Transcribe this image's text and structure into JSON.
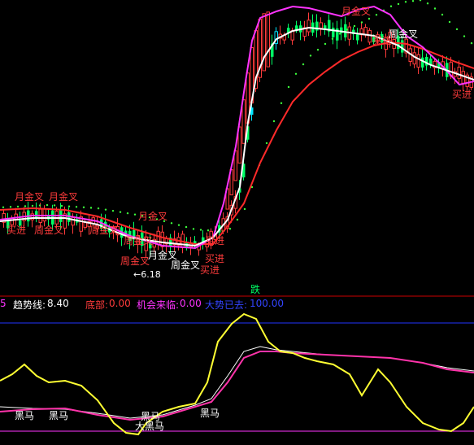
{
  "colors": {
    "background": "#000000",
    "up_candle": "#ff3b3b",
    "down_candle": "#00ff66",
    "cyan_candle": "#00e5ff",
    "ma_white": "#ffffff",
    "ma_magenta": "#ff33ff",
    "ma_red": "#ff2a2a",
    "dots": "#3cff3c",
    "signal_red": "#ff3b3b",
    "signal_white": "#ffffff",
    "axis_red": "#cc0000",
    "axis_blue": "#2233ff",
    "axis_magenta": "#ff33ff",
    "ind_yellow": "#ffff33",
    "ind_magenta": "#ff33aa",
    "ind_white": "#ffffff"
  },
  "price_panel": {
    "bottom_label": "跌",
    "low_marker": "6.18",
    "signals": [
      {
        "text": "周金叉",
        "color": "red"
      },
      {
        "text": "月金叉",
        "color": "red"
      },
      {
        "text": "买进",
        "color": "red"
      },
      {
        "text": "周金叉",
        "color": "red"
      },
      {
        "text": "月金叉",
        "color": "red"
      },
      {
        "text": "周金叉",
        "color": "red"
      },
      {
        "text": "月金叉",
        "color": "white"
      },
      {
        "text": "周金叉",
        "color": "white"
      },
      {
        "text": "买进",
        "color": "red"
      },
      {
        "text": "周金叉",
        "color": "red"
      },
      {
        "text": "月金叉",
        "color": "red"
      },
      {
        "text": "买进",
        "color": "red"
      },
      {
        "text": "买进",
        "color": "red"
      },
      {
        "text": "周金叉",
        "color": "white"
      },
      {
        "text": "买进",
        "color": "red"
      }
    ]
  },
  "indicator_bar": {
    "prefix": "5",
    "trend_label": "趋势线:",
    "trend_value": "8.40",
    "bottom_label": "底部:",
    "bottom_value": "0.00",
    "chance_label": "机会来临:",
    "chance_value": "0.00",
    "bull_label": "大势已去:",
    "bull_value": "100.00"
  },
  "indicator_panel": {
    "labels": [
      {
        "text": "黑马"
      },
      {
        "text": "黑马"
      },
      {
        "text": "黑马"
      },
      {
        "text": "大黑马"
      },
      {
        "text": "黑马"
      }
    ]
  }
}
